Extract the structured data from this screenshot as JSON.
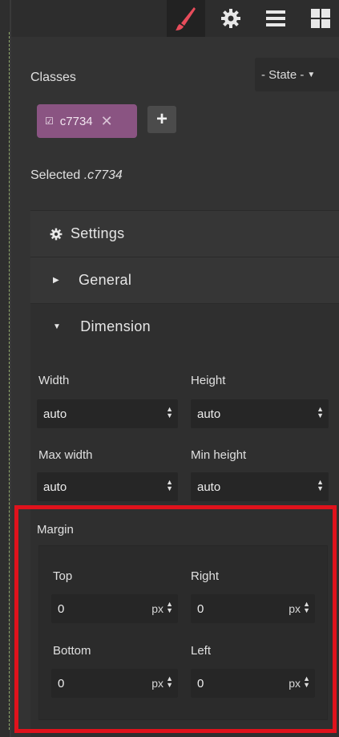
{
  "toolbar": {
    "buttons": [
      {
        "name": "style-manager",
        "icon": "paint-brush-icon",
        "active": true
      },
      {
        "name": "settings",
        "icon": "gear-icon",
        "active": false
      },
      {
        "name": "layers",
        "icon": "layers-icon",
        "active": false
      },
      {
        "name": "blocks",
        "icon": "blocks-grid-icon",
        "active": false
      }
    ],
    "active_color": "#e74c5b"
  },
  "selector": {
    "classes_label": "Classes",
    "state_label": "- State -",
    "tag": {
      "checkbox": "☑",
      "label": "c7734",
      "remove": "✕"
    },
    "add_label": "+",
    "tag_color": "#8a5482",
    "selected_prefix": "Selected",
    "selected_class": ".c7734"
  },
  "sectors": {
    "settings": "Settings",
    "general": "General",
    "dimension": "Dimension"
  },
  "dimension": {
    "width": {
      "label": "Width",
      "value": "auto"
    },
    "height": {
      "label": "Height",
      "value": "auto"
    },
    "max_width": {
      "label": "Max width",
      "value": "auto"
    },
    "min_height": {
      "label": "Min height",
      "value": "auto"
    }
  },
  "margin": {
    "label": "Margin",
    "highlight_color": "#e0121c",
    "top": {
      "label": "Top",
      "value": "0",
      "unit": "px"
    },
    "right": {
      "label": "Right",
      "value": "0",
      "unit": "px"
    },
    "bottom": {
      "label": "Bottom",
      "value": "0",
      "unit": "px"
    },
    "left": {
      "label": "Left",
      "value": "0",
      "unit": "px"
    }
  }
}
